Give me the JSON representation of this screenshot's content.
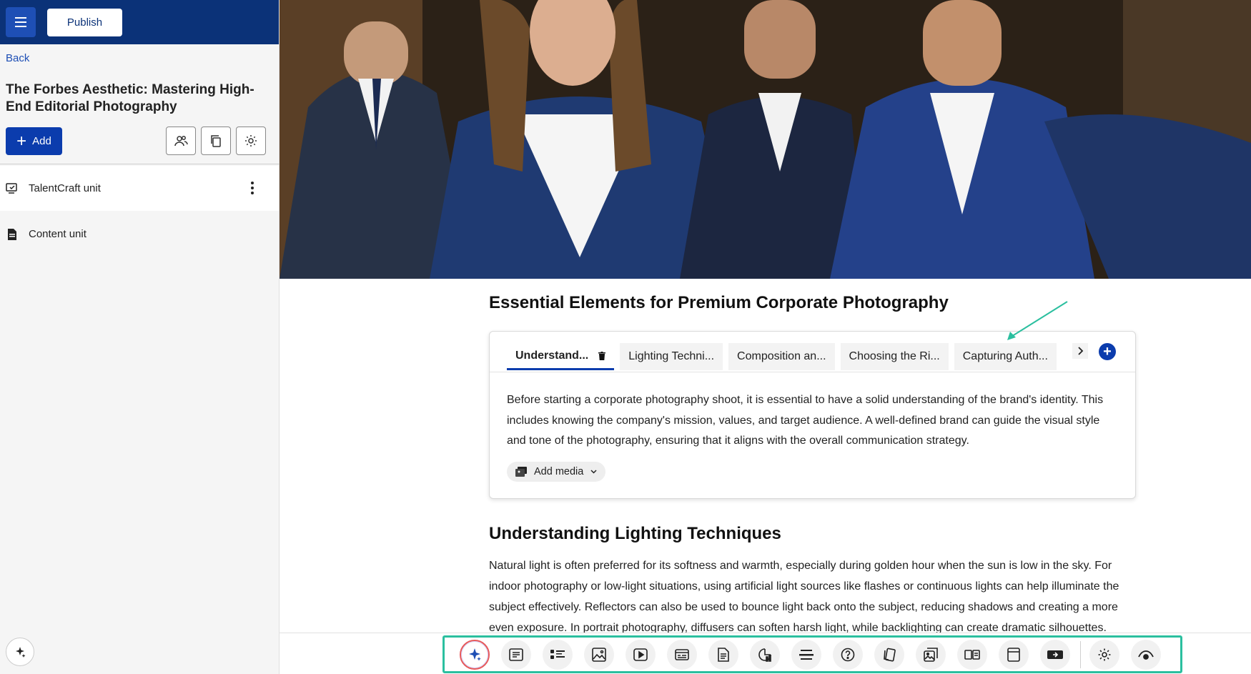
{
  "topbar": {
    "publish_label": "Publish"
  },
  "sidebar": {
    "back_label": "Back",
    "title": "The Forbes Aesthetic: Mastering High-End Editorial Photography",
    "add_label": "Add",
    "items": [
      {
        "label": "TalentCraft unit",
        "icon": "interactive-unit-icon",
        "active": true
      },
      {
        "label": "Content unit",
        "icon": "document-icon",
        "active": false
      }
    ]
  },
  "main": {
    "section_title": "Essential Elements for Premium Corporate Photography",
    "tabs": [
      {
        "label": "Understand...",
        "active": true
      },
      {
        "label": "Lighting Techni...",
        "active": false
      },
      {
        "label": "Composition an...",
        "active": false
      },
      {
        "label": "Choosing the Ri...",
        "active": false
      },
      {
        "label": "Capturing Auth...",
        "active": false
      }
    ],
    "tab_body": "Before starting a corporate photography shoot, it is essential to have a solid understanding of the brand's identity. This includes knowing the company's mission, values, and target audience. A well-defined brand can guide the visual style and tone of the photography, ensuring that it aligns with the overall communication strategy.",
    "add_media_label": "Add media",
    "section2_title": "Understanding Lighting Techniques",
    "section2_body": "Natural light is often preferred for its softness and warmth, especially during golden hour when the sun is low in the sky. For indoor photography or low-light situations, using artificial light sources like flashes or continuous lights can help illuminate the subject effectively. Reflectors can also be used to bounce light back onto the subject, reducing shadows and creating a more even exposure. In portrait photography, diffusers can soften harsh light, while backlighting can create dramatic silhouettes. Using a"
  },
  "toolbar": {
    "tools": [
      "ai-sparkle-icon",
      "text-block-icon",
      "list-icon",
      "image-icon",
      "video-icon",
      "embed-icon",
      "document-icon",
      "chart-icon",
      "divider-icon",
      "question-icon",
      "flashcards-icon",
      "image-gallery-icon",
      "comparison-icon",
      "card-icon",
      "button-icon",
      "settings-icon",
      "preview-icon"
    ]
  },
  "colors": {
    "header_bg": "#0b3278",
    "primary": "#0b3cad",
    "highlight": "#2bbf9f",
    "ai_ring": "#e75a5a"
  }
}
